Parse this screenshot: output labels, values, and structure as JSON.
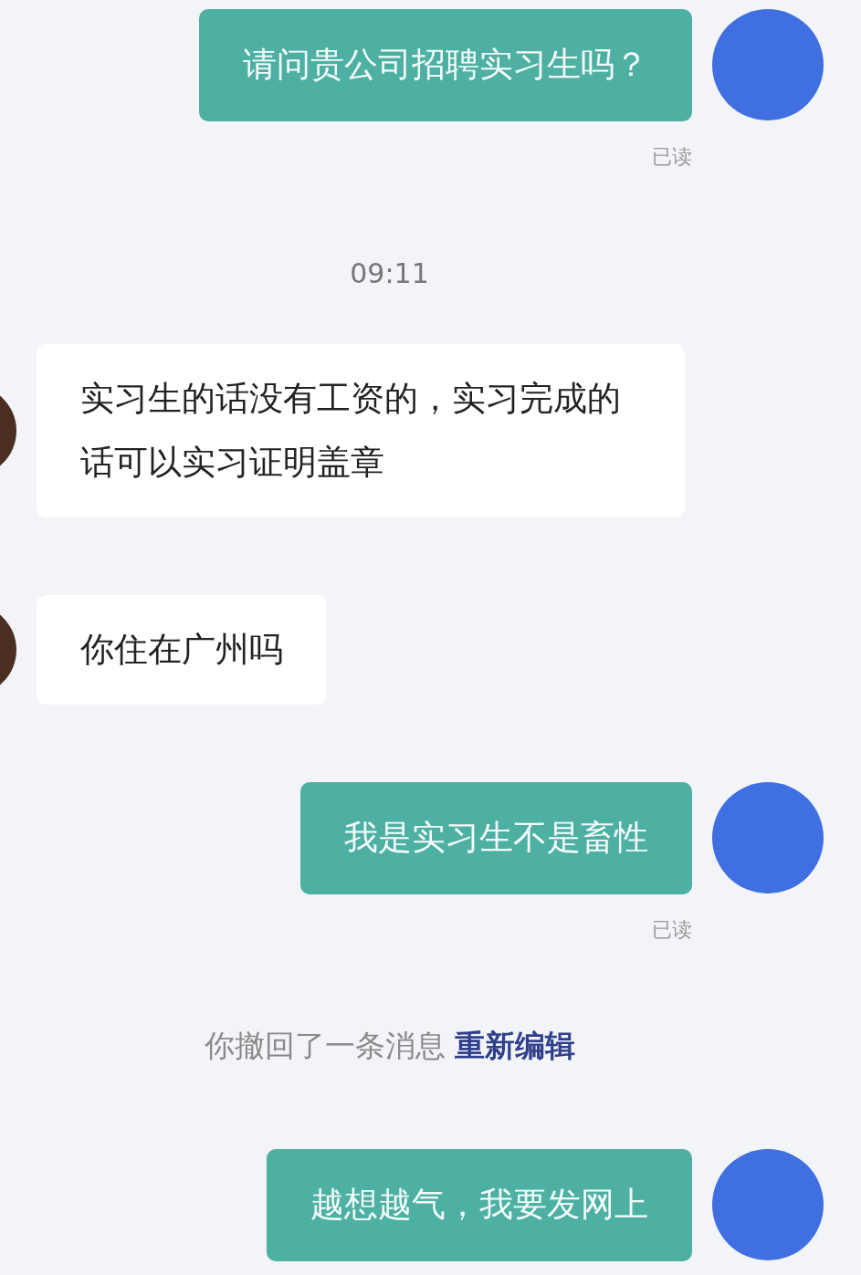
{
  "messages": [
    {
      "kind": "outgoing",
      "text": "请问贵公司招聘实习生吗？",
      "receipt": "已读"
    },
    {
      "kind": "time",
      "text": "09:11"
    },
    {
      "kind": "incoming",
      "text": "实习生的话没有工资的，实习完成的话可以实习证明盖章"
    },
    {
      "kind": "incoming",
      "text": "你住在广州吗"
    },
    {
      "kind": "outgoing",
      "text": "我是实习生不是畜性",
      "receipt": "已读"
    },
    {
      "kind": "system",
      "text": "你撤回了一条消息",
      "link": "重新编辑"
    },
    {
      "kind": "outgoing",
      "text": "越想越气，我要发网上"
    }
  ]
}
